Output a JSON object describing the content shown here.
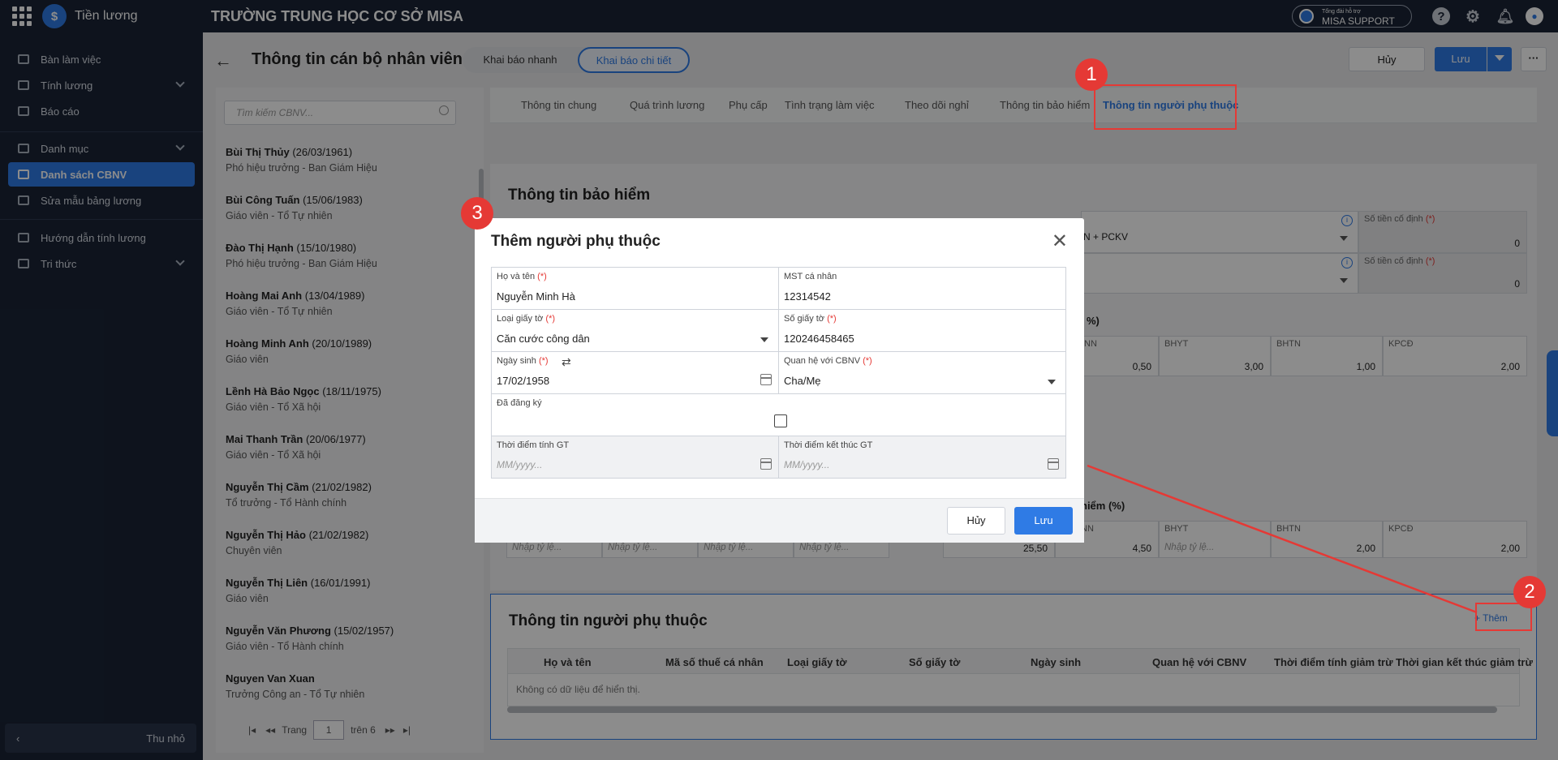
{
  "app": {
    "name": "Tiền lương",
    "school": "TRƯỜNG TRUNG HỌC CƠ SỞ MISA",
    "support_small": "Tổng đài hỗ trợ",
    "support": "MISA SUPPORT"
  },
  "sidebar": {
    "items": [
      {
        "label": "Bàn làm việc"
      },
      {
        "label": "Tính lương"
      },
      {
        "label": "Báo cáo"
      },
      {
        "label": "Danh mục"
      },
      {
        "label": "Danh sách CBNV"
      },
      {
        "label": "Sửa mẫu bảng lương"
      },
      {
        "label": "Hướng dẫn tính lương"
      },
      {
        "label": "Tri thức"
      }
    ],
    "collapse": "Thu nhỏ"
  },
  "header": {
    "title": "Thông tin cán bộ nhân viên",
    "mode_quick": "Khai báo nhanh",
    "mode_detail": "Khai báo chi tiết",
    "cancel": "Hủy",
    "save": "Lưu",
    "more": "···"
  },
  "employees": {
    "search_placeholder": "Tìm kiếm CBNV...",
    "list": [
      {
        "name": "Bùi Thị Thủy",
        "dob": "(26/03/1961)",
        "role": "Phó hiệu trưởng - Ban Giám Hiệu"
      },
      {
        "name": "Bùi Công Tuấn",
        "dob": "(15/06/1983)",
        "role": "Giáo viên - Tổ Tự nhiên"
      },
      {
        "name": "Đào Thị Hạnh",
        "dob": "(15/10/1980)",
        "role": "Phó hiệu trưởng - Ban Giám Hiệu"
      },
      {
        "name": "Hoàng Mai Anh",
        "dob": "(13/04/1989)",
        "role": "Giáo viên - Tổ Tự nhiên"
      },
      {
        "name": "Hoàng Minh Anh",
        "dob": "(20/10/1989)",
        "role": "Giáo viên"
      },
      {
        "name": "Lềnh Hà Bảo Ngọc",
        "dob": "(18/11/1975)",
        "role": "Giáo viên - Tổ Xã hội"
      },
      {
        "name": "Mai Thanh Trần",
        "dob": "(20/06/1977)",
        "role": "Giáo viên - Tổ Xã hội"
      },
      {
        "name": "Nguyễn Thị Cầm",
        "dob": "(21/02/1982)",
        "role": "Tổ trưởng - Tổ Hành chính"
      },
      {
        "name": "Nguyễn Thị Hảo",
        "dob": "(21/02/1982)",
        "role": "Chuyên viên"
      },
      {
        "name": "Nguyễn Thị Liên",
        "dob": "(16/01/1991)",
        "role": "Giáo viên"
      },
      {
        "name": "Nguyễn Văn Phương",
        "dob": "(15/02/1957)",
        "role": "Giáo viên - Tổ Hành chính"
      },
      {
        "name": "Nguyen Van Xuan",
        "dob": "",
        "role": "Trưởng Công an - Tổ Tự nhiên"
      }
    ],
    "pager_label": "Trang",
    "page": "1",
    "of_label": "trên 6"
  },
  "tabs": [
    "Thông tin chung",
    "Quá trình lương",
    "Phụ cấp",
    "Tình trạng làm việc",
    "Theo dõi nghỉ",
    "Thông tin bảo hiểm",
    "Thông tin người phụ thuộc"
  ],
  "insurance": {
    "title": "Thông tin bảo hiểm",
    "formula_text": "N + PCKV",
    "fixed_label": "Số tiền cố định",
    "fixed_value_1": "0",
    "fixed_value_2": "0",
    "pct_label": "%)",
    "row1": [
      {
        "h": "LĐ-BNN",
        "v": "0,50"
      },
      {
        "h": "BHYT",
        "v": "3,00"
      },
      {
        "h": "BHTN",
        "v": "1,00"
      },
      {
        "h": "KPCĐ",
        "v": "2,00"
      }
    ],
    "pct_label_2": "hiểm (%)",
    "row2": [
      {
        "h": "",
        "v": "25,50"
      },
      {
        "h": "LĐ-BNN",
        "v": "4,50"
      },
      {
        "h": "BHYT",
        "v": ""
      },
      {
        "h": "BHTN",
        "v": "2,00"
      },
      {
        "h": "KPCĐ",
        "v": "2,00"
      }
    ],
    "rate_placeholder": "Nhập tỷ lệ...",
    "rate_placeholder_short": "Nhập tỷ lệ..."
  },
  "dependents": {
    "title": "Thông tin người phụ thuộc",
    "add": "+ Thêm",
    "columns": [
      "Họ và tên",
      "Mã số thuế cá nhân",
      "Loại giấy tờ",
      "Số giấy tờ",
      "Ngày sinh",
      "Quan hệ với CBNV",
      "Thời điểm tính giảm trừ",
      "Thời gian kết thúc giảm trừ"
    ],
    "empty": "Không có dữ liệu để hiển thị."
  },
  "dialog": {
    "title": "Thêm người phụ thuộc",
    "req": "(*)",
    "name_label": "Họ và tên",
    "name_value": "Nguyễn Minh Hà",
    "tax_label": "MST cá nhân",
    "tax_value": "12314542",
    "doc_type_label": "Loại giấy tờ",
    "doc_type_value": "Căn cước công dân",
    "doc_no_label": "Số giấy tờ",
    "doc_no_value": "120246458465",
    "dob_label": "Ngày sinh",
    "dob_value": "17/02/1958",
    "rel_label": "Quan hệ với CBNV",
    "rel_value": "Cha/Mẹ",
    "registered_label": "Đã đăng ký",
    "start_label": "Thời điểm tính GT",
    "start_ph": "MM/yyyy...",
    "end_label": "Thời điểm kết thúc GT",
    "end_ph": "MM/yyyy...",
    "cancel": "Hủy",
    "save": "Lưu"
  },
  "callouts": [
    "1",
    "2",
    "3"
  ],
  "colors": {
    "accent": "#2f7be5",
    "sidebar": "#1a2436",
    "callout": "#e53935"
  }
}
